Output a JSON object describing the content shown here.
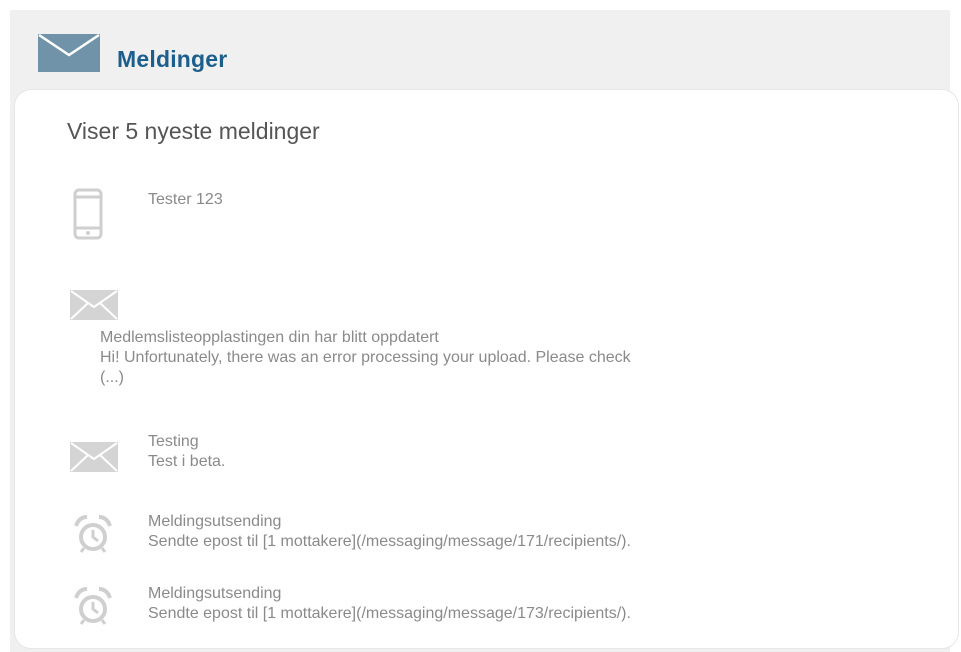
{
  "header": {
    "title": "Meldinger",
    "icon": "envelope-icon"
  },
  "card": {
    "heading": "Viser 5 nyeste meldinger"
  },
  "messages": [
    {
      "icon": "phone-icon",
      "title": "Tester 123",
      "body": ""
    },
    {
      "icon": "envelope-icon",
      "title": "Medlemslisteopplastingen din har blitt oppdatert",
      "body": "Hi! Unfortunately, there was an error processing your upload. Please check",
      "body_more": "(...)"
    },
    {
      "icon": "envelope-icon",
      "title": "Testing",
      "body": "Test i beta."
    },
    {
      "icon": "alarm-clock-icon",
      "title": "Meldingsutsending",
      "body": "Sendte epost til [1 mottakere](/messaging/message/171/recipients/)."
    },
    {
      "icon": "alarm-clock-icon",
      "title": "Meldingsutsending",
      "body": "Sendte epost til [1 mottakere](/messaging/message/173/recipients/)."
    }
  ],
  "colors": {
    "header_title": "#1d5f8c",
    "header_icon": "#6f8fa6",
    "message_icon": "#cfcfcf",
    "message_text": "#8a8a8a",
    "panel_bg": "#f0f0f0"
  }
}
